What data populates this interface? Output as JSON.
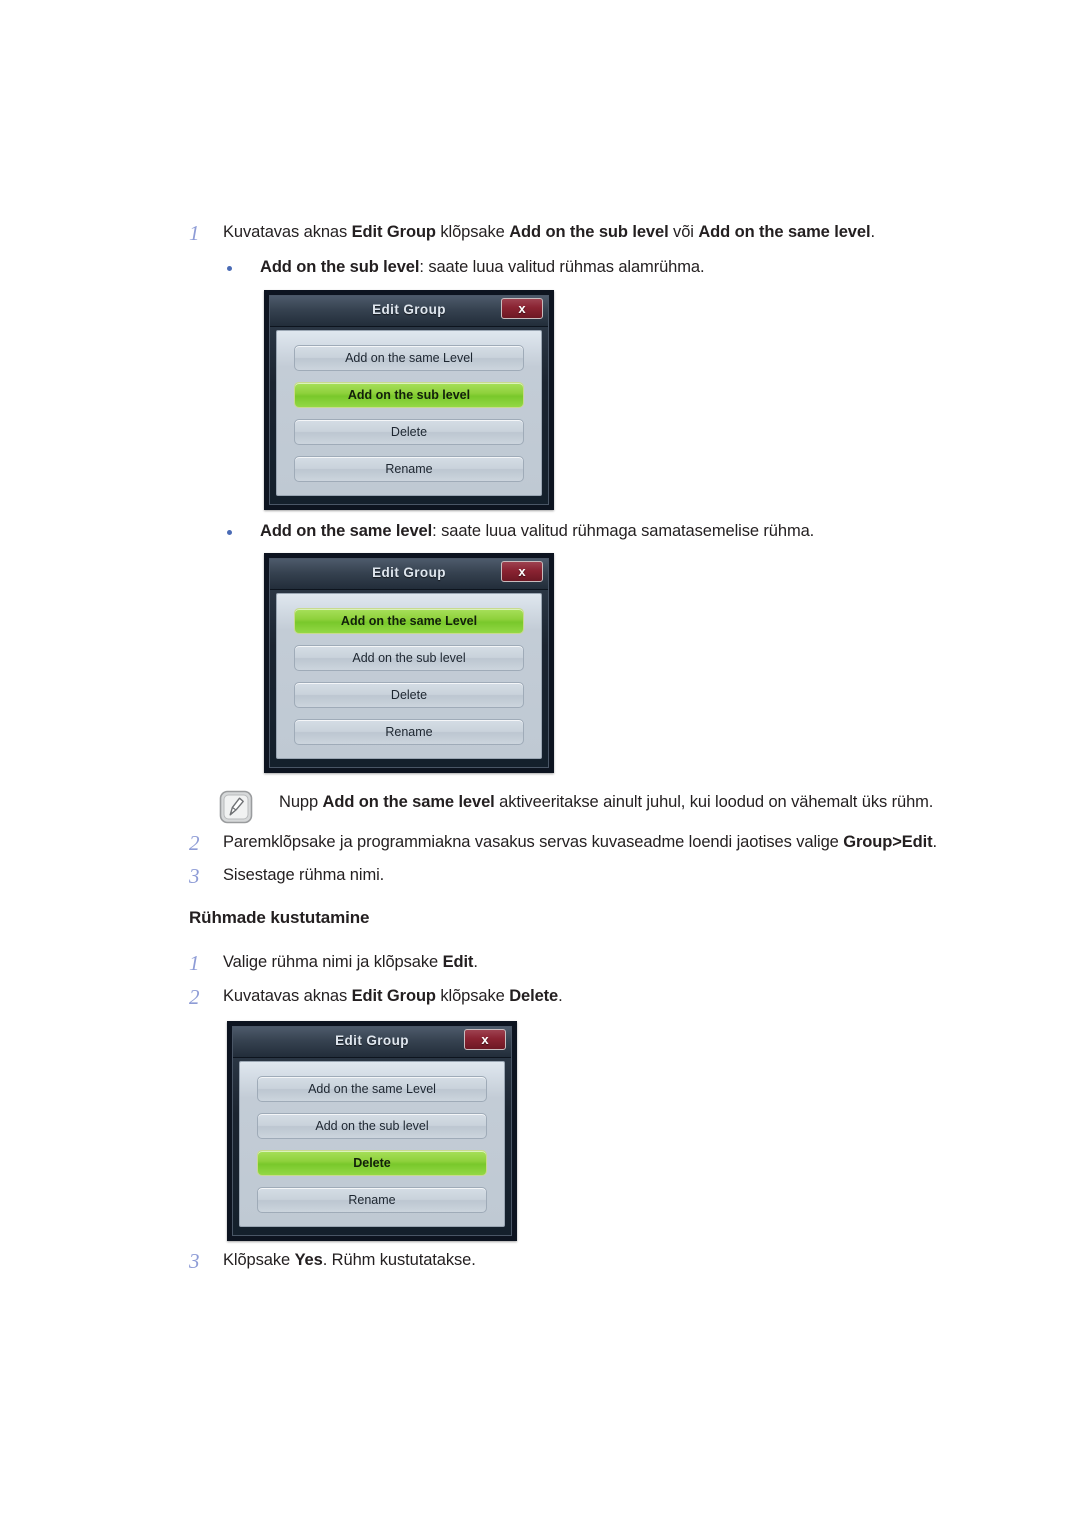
{
  "document": {
    "language": "et",
    "accent_number_color": "#8e9cd6",
    "bullet_color": "#4a6bb5",
    "highlight_green": "#8fd13c",
    "dialog_close_red": "#8a2332"
  },
  "steps": [
    {
      "number": "1",
      "segments": [
        {
          "text": "Kuvatavas aknas ",
          "bold": false
        },
        {
          "text": "Edit Group",
          "bold": true
        },
        {
          "text": " klõpsake ",
          "bold": false
        },
        {
          "text": "Add on the sub level",
          "bold": true
        },
        {
          "text": " või ",
          "bold": false
        },
        {
          "text": "Add on the same level",
          "bold": true
        },
        {
          "text": ".",
          "bold": false
        }
      ]
    }
  ],
  "bullets": [
    {
      "segments": [
        {
          "text": "Add on the sub level",
          "bold": true
        },
        {
          "text": ": saate luua valitud rühmas alamrühma.",
          "bold": false
        }
      ]
    },
    {
      "segments": [
        {
          "text": "Add on the same level",
          "bold": true
        },
        {
          "text": ": saate luua valitud rühmaga samatasemelise rühma.",
          "bold": false
        }
      ]
    }
  ],
  "note": {
    "icon": "note-pencil-icon",
    "segments": [
      {
        "text": "Nupp ",
        "bold": false
      },
      {
        "text": "Add on the same level",
        "bold": true
      },
      {
        "text": " aktiveeritakse ainult juhul, kui loodud on vähemalt üks rühm.",
        "bold": false
      }
    ]
  },
  "steps_after_note": [
    {
      "number": "2",
      "segments": [
        {
          "text": "Paremklõpsake ja programmiakna vasakus servas kuvaseadme loendi jaotises valige ",
          "bold": false
        },
        {
          "text": "Group>Edit",
          "bold": true
        },
        {
          "text": ".",
          "bold": false
        }
      ]
    },
    {
      "number": "3",
      "segments": [
        {
          "text": "Sisestage rühma nimi.",
          "bold": false
        }
      ]
    }
  ],
  "section": {
    "heading": "Rühmade kustutamine",
    "steps": [
      {
        "number": "1",
        "segments": [
          {
            "text": "Valige rühma nimi ja klõpsake ",
            "bold": false
          },
          {
            "text": "Edit",
            "bold": true
          },
          {
            "text": ".",
            "bold": false
          }
        ]
      },
      {
        "number": "2",
        "segments": [
          {
            "text": "Kuvatavas aknas ",
            "bold": false
          },
          {
            "text": "Edit Group",
            "bold": true
          },
          {
            "text": " klõpsake ",
            "bold": false
          },
          {
            "text": "Delete",
            "bold": true
          },
          {
            "text": ".",
            "bold": false
          }
        ]
      },
      {
        "number": "3",
        "segments": [
          {
            "text": "Klõpsake ",
            "bold": false
          },
          {
            "text": "Yes",
            "bold": true
          },
          {
            "text": ". Rühm kustutatakse.",
            "bold": false
          }
        ]
      }
    ]
  },
  "dialogs": [
    {
      "id": "dialog-sub-level",
      "title": "Edit Group",
      "close_label": "x",
      "buttons": [
        {
          "label": "Add on the same Level",
          "selected": false
        },
        {
          "label": "Add on the sub level",
          "selected": true
        },
        {
          "label": "Delete",
          "selected": false
        },
        {
          "label": "Rename",
          "selected": false
        }
      ]
    },
    {
      "id": "dialog-same-level",
      "title": "Edit Group",
      "close_label": "x",
      "buttons": [
        {
          "label": "Add on the same Level",
          "selected": true
        },
        {
          "label": "Add on the sub level",
          "selected": false
        },
        {
          "label": "Delete",
          "selected": false
        },
        {
          "label": "Rename",
          "selected": false
        }
      ]
    },
    {
      "id": "dialog-delete",
      "title": "Edit Group",
      "close_label": "x",
      "buttons": [
        {
          "label": "Add on the same Level",
          "selected": false
        },
        {
          "label": "Add on the sub level",
          "selected": false
        },
        {
          "label": "Delete",
          "selected": true
        },
        {
          "label": "Rename",
          "selected": false
        }
      ]
    }
  ]
}
